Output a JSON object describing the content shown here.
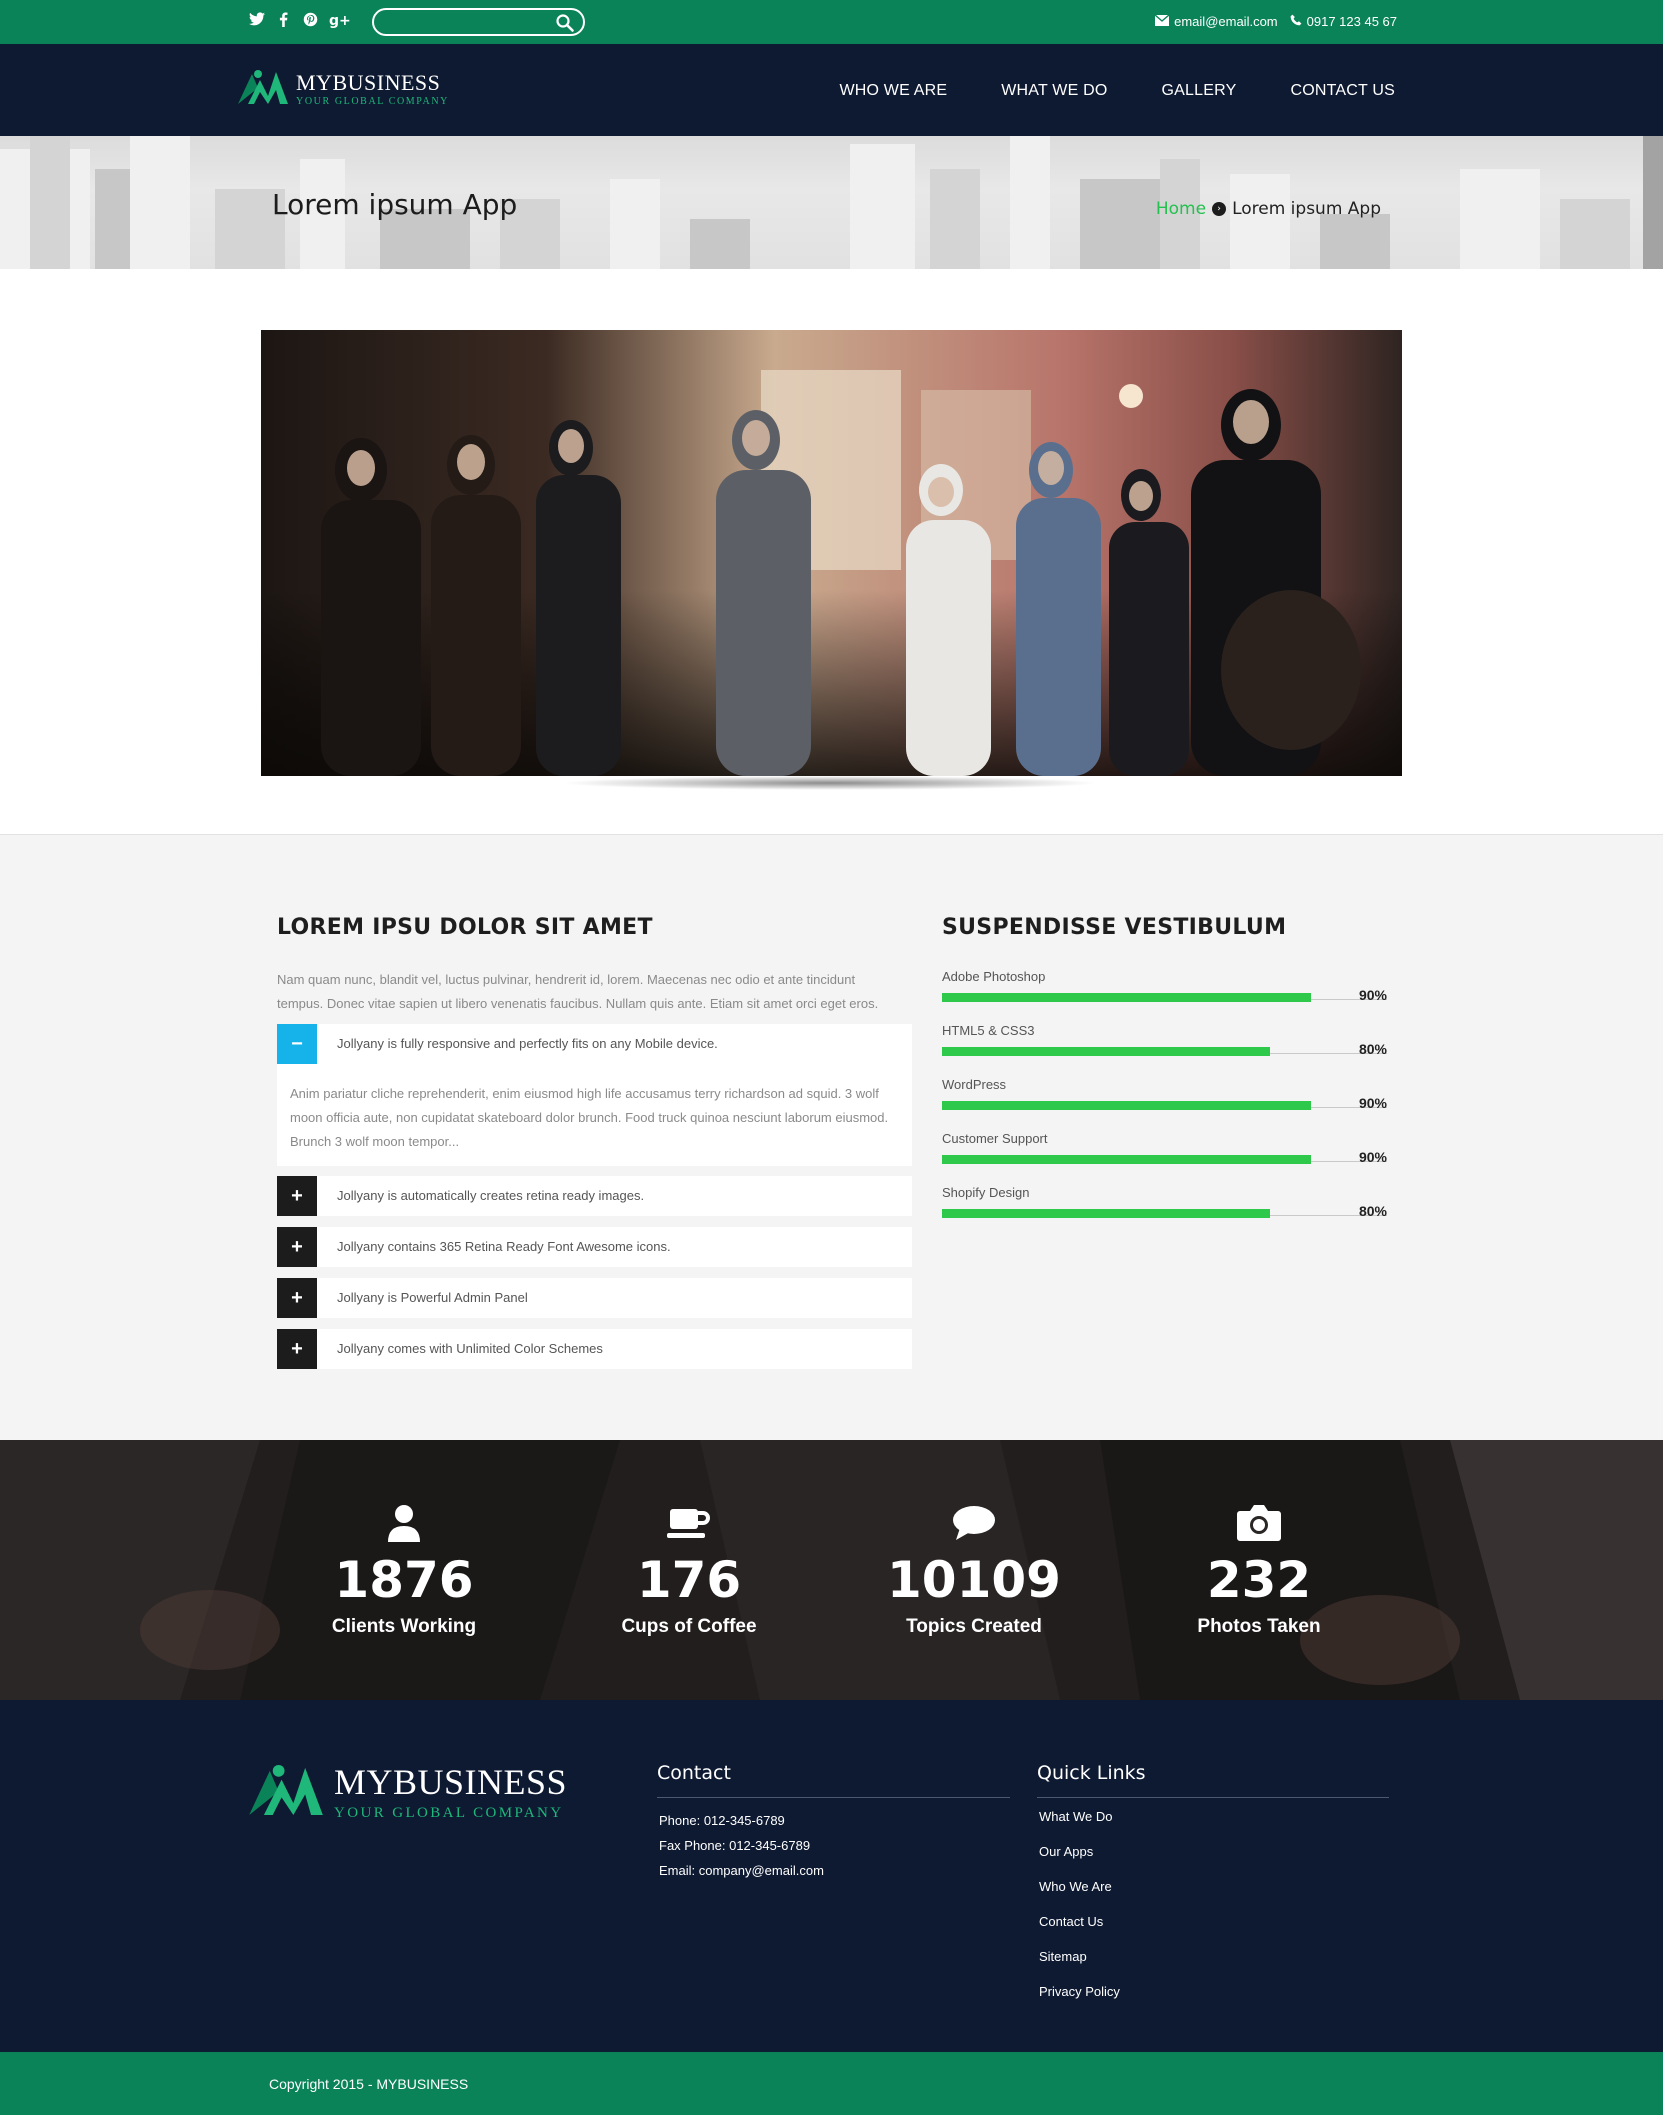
{
  "topbar": {
    "social": [
      "twitter-icon",
      "facebook-icon",
      "pinterest-icon",
      "google-plus-icon"
    ],
    "search": {
      "placeholder": "",
      "value": ""
    },
    "email": "email@email.com",
    "phone": "0917 123 45 67"
  },
  "nav": {
    "brand_name": "MYBUSINESS",
    "brand_tag": "YOUR GLOBAL COMPANY",
    "items": [
      "WHO WE ARE",
      "WHAT WE DO",
      "GALLERY",
      "CONTACT US"
    ]
  },
  "banner": {
    "title": "Lorem ipsum App",
    "breadcrumb_home": "Home",
    "breadcrumb_current": "Lorem ipsum App"
  },
  "left": {
    "heading": "LOREM IPSU DOLOR SIT AMET",
    "intro": "Nam quam nunc, blandit vel, luctus pulvinar, hendrerit id, lorem. Maecenas nec odio et ante tincidunt tempus. Donec vitae sapien ut libero venenatis faucibus. Nullam quis ante. Etiam sit amet orci eget eros.",
    "accordion": [
      {
        "title": "Jollyany is fully responsive and perfectly fits on any Mobile device.",
        "state": "open",
        "body": "Anim pariatur cliche reprehenderit, enim eiusmod high life accusamus terry richardson ad squid. 3 wolf moon officia aute, non cupidatat skateboard dolor brunch. Food truck quinoa nesciunt laborum eiusmod. Brunch 3 wolf moon tempor..."
      },
      {
        "title": "Jollyany is automatically creates retina ready images.",
        "state": "closed"
      },
      {
        "title": "Jollyany contains 365 Retina Ready Font Awesome icons.",
        "state": "closed"
      },
      {
        "title": "Jollyany is Powerful Admin Panel",
        "state": "closed"
      },
      {
        "title": "Jollyany comes with Unlimited Color Schemes",
        "state": "closed"
      }
    ],
    "open_symbol": "−",
    "closed_symbol": "+"
  },
  "right": {
    "heading": "SUSPENDISSE VESTIBULUM",
    "skills": [
      {
        "label": "Adobe Photoshop",
        "percent": 90,
        "percent_label": "90%"
      },
      {
        "label": "HTML5 & CSS3",
        "percent": 80,
        "percent_label": "80%"
      },
      {
        "label": "WordPress",
        "percent": 90,
        "percent_label": "90%"
      },
      {
        "label": "Customer Support",
        "percent": 90,
        "percent_label": "90%"
      },
      {
        "label": "Shopify Design",
        "percent": 80,
        "percent_label": "80%"
      }
    ],
    "bar_color": "#2ec84a"
  },
  "counters": [
    {
      "icon": "user-icon",
      "value": "1876",
      "label": "Clients Working"
    },
    {
      "icon": "coffee-cup-icon",
      "value": "176",
      "label": "Cups of Coffee"
    },
    {
      "icon": "chat-bubble-icon",
      "value": "10109",
      "label": "Topics Created"
    },
    {
      "icon": "camera-icon",
      "value": "232",
      "label": "Photos Taken"
    }
  ],
  "footer": {
    "brand_name": "MYBUSINESS",
    "brand_tag": "YOUR GLOBAL COMPANY",
    "contact_title": "Contact",
    "contact_lines": [
      "Phone: 012-345-6789",
      "Fax Phone: 012-345-6789",
      "Email: company@email.com"
    ],
    "links_title": "Quick Links",
    "links": [
      "What We Do",
      "Our Apps",
      "Who We Are",
      "Contact Us",
      "Sitemap",
      "Privacy Policy"
    ],
    "copyright": "Copyright 2015 - MYBUSINESS"
  },
  "colors": {
    "green": "#0b8359",
    "navy": "#0e1a32",
    "accent_green": "#25c04f",
    "accordion_open": "#16b2ea"
  }
}
